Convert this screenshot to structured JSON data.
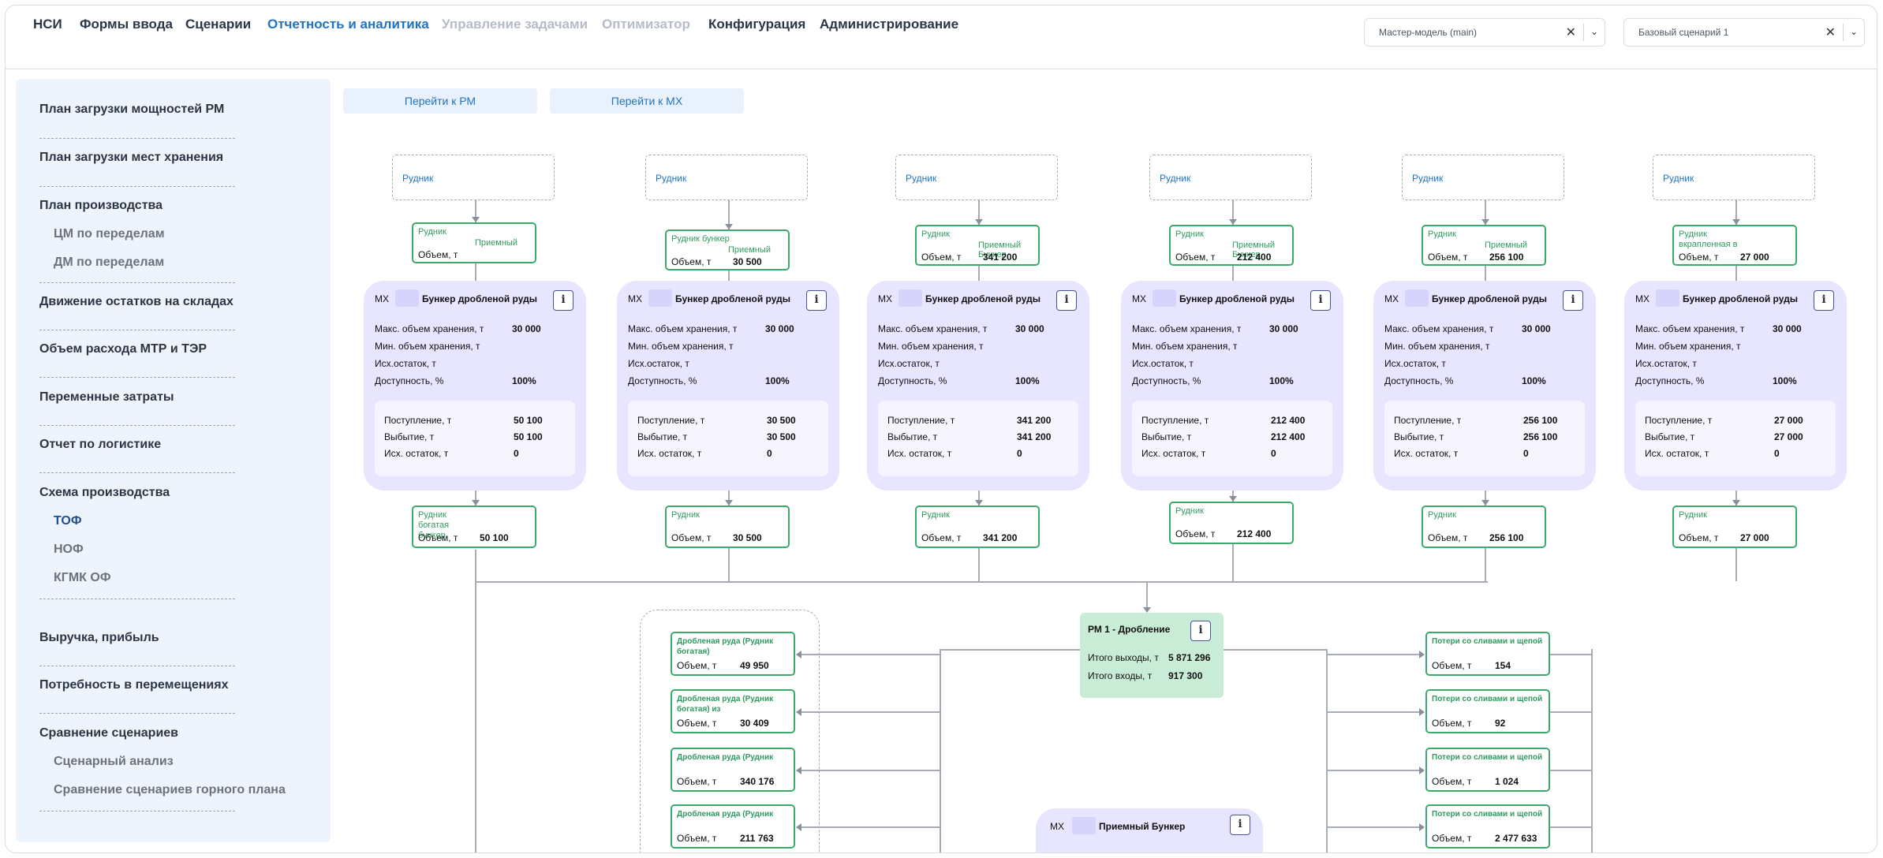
{
  "nav": {
    "items": [
      {
        "label": "НСИ",
        "state": "normal"
      },
      {
        "label": "Формы ввода",
        "state": "normal"
      },
      {
        "label": "Сценарии",
        "state": "normal"
      },
      {
        "label": "Отчетность и аналитика",
        "state": "active"
      },
      {
        "label": "Управление задачами",
        "state": "disabled"
      },
      {
        "label": "Оптимизатор",
        "state": "disabled"
      },
      {
        "label": "Конфигурация",
        "state": "normal"
      },
      {
        "label": "Администрирование",
        "state": "normal"
      }
    ],
    "model_select": "Мастер-модель (main)",
    "scenario_select": "Базовый сценарий 1"
  },
  "sidebar": {
    "groups": [
      {
        "label": "План загрузки мощностей РМ"
      },
      {
        "label": "План загрузки мест хранения"
      },
      {
        "label": "План производства",
        "sub": [
          "ЦМ по переделам",
          "ДМ по переделам"
        ]
      },
      {
        "label": "Движение остатков на складах"
      },
      {
        "label": "Объем расхода МТР и ТЭР"
      },
      {
        "label": "Переменные затраты"
      },
      {
        "label": "Отчет по логистике"
      },
      {
        "label": "Схема производства",
        "sub": [
          "ТОФ",
          "НОФ",
          "КГМК ОФ"
        ]
      },
      {
        "label": "Выручка, прибыль"
      },
      {
        "label": "Потребность в перемещениях"
      },
      {
        "label": "Сравнение сценариев",
        "sub": [
          "Сценарный анализ",
          "Сравнение сценариев горного плана"
        ]
      }
    ],
    "active_sub": "ТОФ"
  },
  "buttons": {
    "goto_rm": "Перейти к РМ",
    "goto_mx": "Перейти к МХ"
  },
  "labels": {
    "mine": "Рудник",
    "volume": "Объем, т",
    "mx": "МХ",
    "bunker": "Бункер дробленой руды",
    "max_storage": "Макс. объем хранения, т",
    "min_storage": "Мин. объем хранения, т",
    "init_stock": "Исх.остаток, т",
    "availability": "Доступность, %",
    "income": "Поступление, т",
    "outflow": "Выбытие, т",
    "out_stock": "Исх. остаток, т",
    "info": "i"
  },
  "columns": [
    {
      "in_title": "Рудник",
      "in_title2": "Приемный",
      "in_volume": "",
      "max": "30 000",
      "avail": "100%",
      "income": "50 100",
      "outflow": "50 100",
      "rest": "0",
      "out_title": "Рудник богатая бункер",
      "out_volume": "50 100"
    },
    {
      "in_title": "Рудник бункер",
      "in_title2": "Приемный",
      "in_volume": "30 500",
      "max": "30 000",
      "avail": "100%",
      "income": "30 500",
      "outflow": "30 500",
      "rest": "0",
      "out_title": "Рудник",
      "out_volume": "30 500"
    },
    {
      "in_title": "Рудник",
      "in_title2": "Приемный Бункер",
      "in_volume": "341 200",
      "max": "30 000",
      "avail": "100%",
      "income": "341 200",
      "outflow": "341 200",
      "rest": "0",
      "out_title": "Рудник",
      "out_volume": "341 200"
    },
    {
      "in_title": "Рудник",
      "in_title2": "Приемный Бункер",
      "in_volume": "212 400",
      "max": "30 000",
      "avail": "100%",
      "income": "212 400",
      "outflow": "212 400",
      "rest": "0",
      "out_title": "Рудник",
      "out_volume": "212 400"
    },
    {
      "in_title": "Рудник",
      "in_title2": "Приемный",
      "in_volume": "256 100",
      "max": "30 000",
      "avail": "100%",
      "income": "256 100",
      "outflow": "256 100",
      "rest": "0",
      "out_title": "Рудник",
      "out_volume": "256 100"
    },
    {
      "in_title": "Рудник вкрапленная в",
      "in_title2": "",
      "in_volume": "27 000",
      "max": "30 000",
      "avail": "100%",
      "income": "27 000",
      "outflow": "27 000",
      "rest": "0",
      "out_title": "Рудник",
      "out_volume": "27 000"
    }
  ],
  "rm": {
    "title": "РМ 1 - Дробление",
    "out_label": "Итого выходы, т",
    "out_value": "5 871 296",
    "in_label": "Итого входы, т",
    "in_value": "917 300"
  },
  "outputs": [
    {
      "title": "Дробленая руда (Рудник богатая)",
      "volume": "49 950"
    },
    {
      "title": "Дробленая руда (Рудник богатая) из",
      "volume": "30 409"
    },
    {
      "title": "Дробленая руда (Рудник",
      "volume": "340 176"
    },
    {
      "title": "Дробленая руда (Рудник",
      "volume": "211 763"
    }
  ],
  "losses": [
    {
      "title": "Потери со сливами и щепой",
      "volume": "154"
    },
    {
      "title": "Потери со сливами и щепой",
      "volume": "92"
    },
    {
      "title": "Потери со сливами и щепой",
      "volume": "1 024"
    },
    {
      "title": "Потери со сливами и щепой",
      "volume": "2 477 633"
    }
  ],
  "bottom_mx": {
    "label": "МХ",
    "title": "Приемный Бункер"
  }
}
